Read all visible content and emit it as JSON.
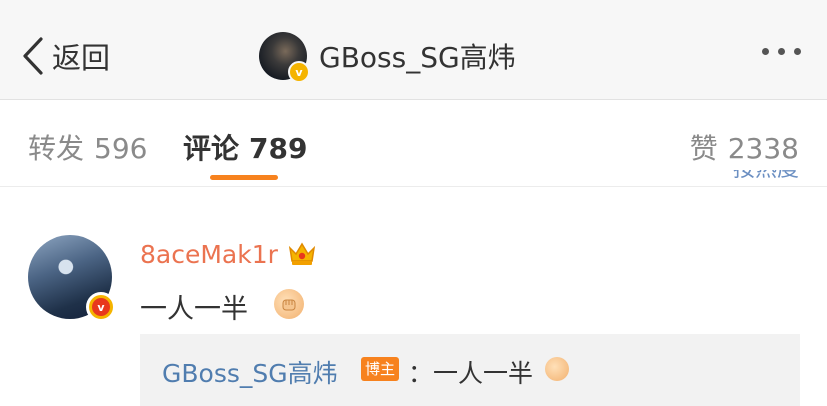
{
  "nav": {
    "back_label": "返回",
    "title": "GBoss_SG高炜",
    "accent_color": "#f7821e"
  },
  "tabs": {
    "repost": {
      "label": "转发",
      "count": "596"
    },
    "comment": {
      "label": "评论",
      "count": "789"
    },
    "like": {
      "label": "赞",
      "count": "2338"
    },
    "sort_peek": "按热度"
  },
  "comment": {
    "username": "8aceMak1r",
    "text": "一人一半",
    "icons": [
      "crown-icon",
      "fist-emoji",
      "verified-icon"
    ],
    "reply": {
      "author": "GBoss_SG高炜",
      "badge": "博主",
      "text": "：一人一半"
    }
  }
}
